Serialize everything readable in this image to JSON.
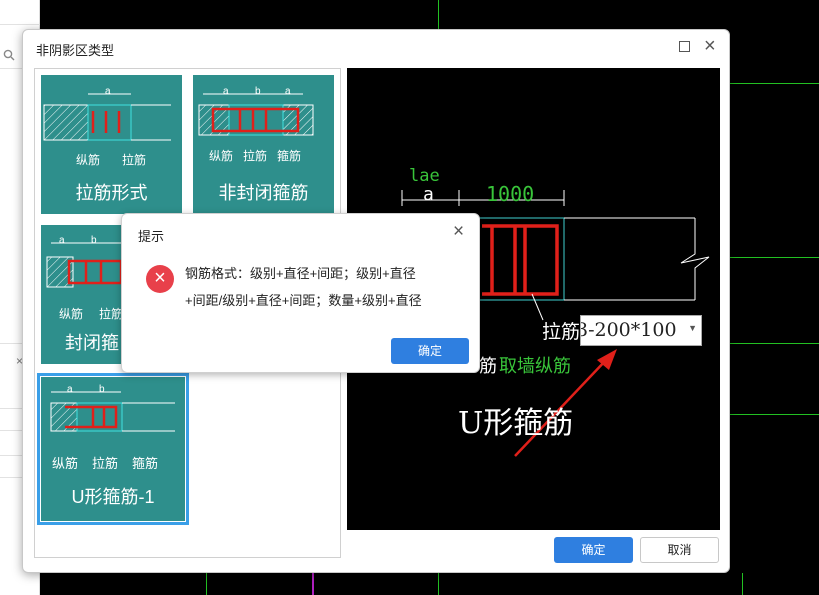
{
  "dialog": {
    "title": "非阴影区类型",
    "ok_label": "确定",
    "cancel_label": "取消"
  },
  "tiles": [
    {
      "name": "拉筋形式",
      "labels": [
        "纵筋",
        "拉筋"
      ],
      "dim": "a"
    },
    {
      "name": "非封闭箍筋",
      "labels": [
        "纵筋",
        "拉筋",
        "箍筋"
      ],
      "dims": [
        "a",
        "b",
        "a"
      ]
    },
    {
      "name": "封闭箍",
      "labels": [
        "纵筋",
        "拉筋"
      ],
      "dims": [
        "a",
        "b"
      ]
    },
    {
      "name": "U形箍筋-1",
      "labels": [
        "纵筋",
        "拉筋",
        "箍筋"
      ],
      "dims": [
        "a",
        "b"
      ],
      "selected": true
    }
  ],
  "preview": {
    "lae": "lae",
    "a": "a",
    "len": "1000",
    "tie_label": "拉筋",
    "input_value": "3-200*100",
    "rebar_prefix": "筋",
    "take_wall": "取墙纵筋",
    "caption": "U形箍筋"
  },
  "alert": {
    "title": "提示",
    "line1": "钢筋格式：级别+直径+间距；级别+直径",
    "line2": "+间距/级别+直径+间距；数量+级别+直径",
    "ok_label": "确定"
  },
  "colors": {
    "tile_bg": "#2e8f8c",
    "accent": "#2f7fe0",
    "rebar": "#e0201a",
    "cad_green": "#39c43a"
  }
}
